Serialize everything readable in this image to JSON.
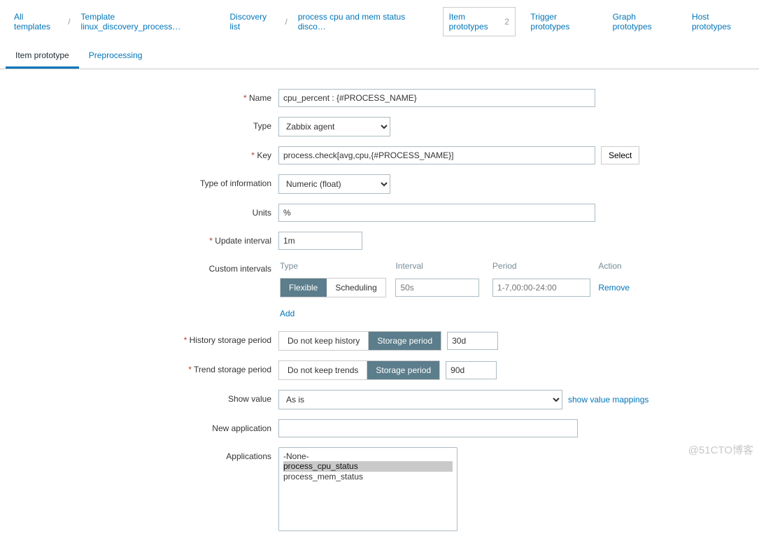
{
  "breadcrumbs": {
    "all_templates": "All templates",
    "template_linux": "Template linux_discovery_process…",
    "discovery_list": "Discovery list",
    "process_rule": "process cpu and mem status disco…",
    "item_prototypes": "Item prototypes",
    "item_prototypes_count": "2",
    "trigger_prototypes": "Trigger prototypes",
    "graph_prototypes": "Graph prototypes",
    "host_prototypes": "Host prototypes"
  },
  "tabs": {
    "item_prototype": "Item prototype",
    "preprocessing": "Preprocessing"
  },
  "labels": {
    "name": "Name",
    "type": "Type",
    "key": "Key",
    "type_of_information": "Type of information",
    "units": "Units",
    "update_interval": "Update interval",
    "custom_intervals": "Custom intervals",
    "history_storage_period": "History storage period",
    "trend_storage_period": "Trend storage period",
    "show_value": "Show value",
    "new_application": "New application",
    "applications": "Applications"
  },
  "fields": {
    "name": "cpu_percent : {#PROCESS_NAME}",
    "type": "Zabbix agent",
    "key": "process.check[avg,cpu,{#PROCESS_NAME}]",
    "select_btn": "Select",
    "type_of_information": "Numeric (float)",
    "units": "%",
    "update_interval": "1m"
  },
  "custom_intervals": {
    "headers": {
      "type": "Type",
      "interval": "Interval",
      "period": "Period",
      "action": "Action"
    },
    "flexible": "Flexible",
    "scheduling": "Scheduling",
    "interval_placeholder": "50s",
    "period_placeholder": "1-7,00:00-24:00",
    "remove": "Remove",
    "add": "Add"
  },
  "history": {
    "no_keep": "Do not keep history",
    "storage_period": "Storage period",
    "value": "30d"
  },
  "trend": {
    "no_keep": "Do not keep trends",
    "storage_period": "Storage period",
    "value": "90d"
  },
  "show_value": {
    "selected": "As is",
    "link": "show value mappings"
  },
  "new_application": "",
  "applications": {
    "none": "-None-",
    "selected": "process_cpu_status",
    "other": "process_mem_status"
  },
  "watermark": "@51CTO博客"
}
